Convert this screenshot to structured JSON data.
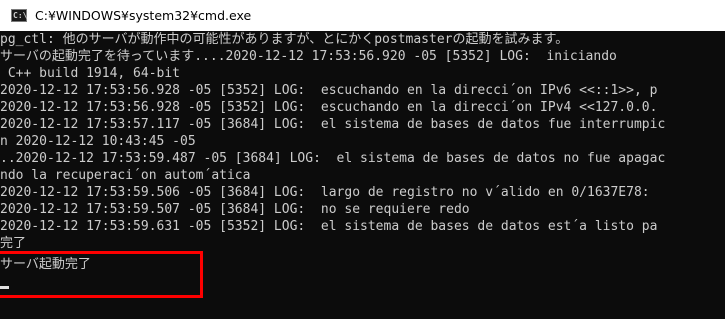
{
  "window": {
    "title": "C:¥WINDOWS¥system32¥cmd.exe",
    "icon": "cmd-icon",
    "icon_glyph": "C:\\"
  },
  "console": {
    "lines": [
      "pg_ctl: 他のサーバが動作中の可能性がありますが、とにかくpostmasterの起動を試みます。",
      "サーバの起動完了を待っています....2020-12-12 17:53:56.920 -05 [5352] LOG:  iniciando",
      " C++ build 1914, 64-bit",
      "2020-12-12 17:53:56.928 -05 [5352] LOG:  escuchando en la direcci´on IPv6 <<::1>>, p",
      "2020-12-12 17:53:56.928 -05 [5352] LOG:  escuchando en la direcci´on IPv4 <<127.0.0.",
      "2020-12-12 17:53:57.117 -05 [3684] LOG:  el sistema de bases de datos fue interrumpic",
      "n 2020-12-12 10:43:45 -05",
      "..2020-12-12 17:53:59.487 -05 [3684] LOG:  el sistema de bases de datos no fue apagac",
      "ndo la recuperaci´on autom´atica",
      "2020-12-12 17:53:59.506 -05 [3684] LOG:  largo de registro no v´alido en 0/1637E78:",
      "2020-12-12 17:53:59.507 -05 [3684] LOG:  no se requiere redo",
      "2020-12-12 17:53:59.631 -05 [5352] LOG:  el sistema de bases de datos est´a listo pa",
      "完了",
      "",
      "サーバ起動完了"
    ]
  },
  "colors": {
    "console_bg": "#0c0c0c",
    "console_text": "#cccccc",
    "highlight": "#ff0000"
  }
}
